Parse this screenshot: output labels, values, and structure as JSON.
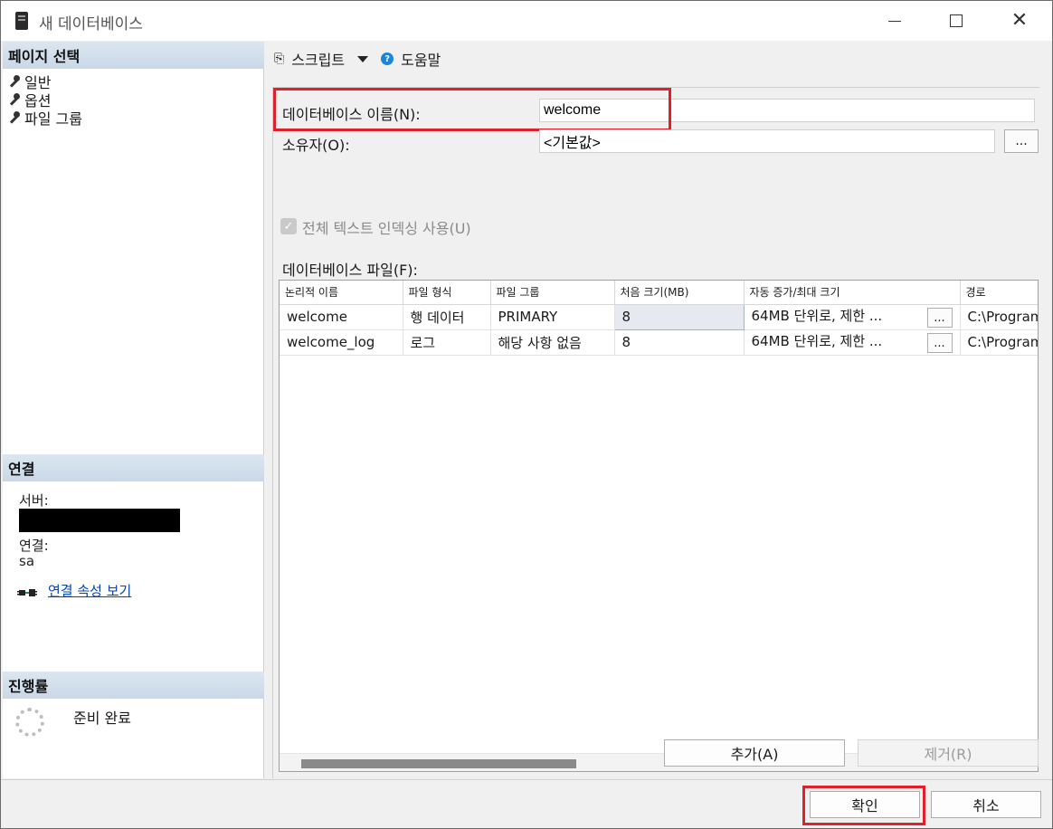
{
  "window": {
    "title": "새 데이터베이스"
  },
  "left": {
    "page_select_header": "페이지 선택",
    "pages": [
      "일반",
      "옵션",
      "파일 그룹"
    ],
    "connection_header": "연결",
    "server_label": "서버:",
    "connection_label": "연결:",
    "connection_value": "sa",
    "view_conn_props": "연결 속성 보기",
    "progress_header": "진행률",
    "progress_status": "준비 완료"
  },
  "toolbar": {
    "script_label": "스크립트",
    "help_label": "도움말"
  },
  "form": {
    "db_name_label": "데이터베이스 이름(N):",
    "db_name_value": "welcome",
    "owner_label": "소유자(O):",
    "owner_value": "<기본값>",
    "owner_browse": "...",
    "fulltext_label": "전체 텍스트 인덱싱 사용(U)",
    "files_label": "데이터베이스 파일(F):"
  },
  "grid": {
    "columns": [
      "논리적 이름",
      "파일 형식",
      "파일 그룹",
      "처음 크기(MB)",
      "자동 증가/최대 크기",
      "경로"
    ],
    "rows": [
      {
        "name": "welcome",
        "type": "행 데이터",
        "group": "PRIMARY",
        "size": "8",
        "autogrowth": "64MB 단위로, 제한 ...",
        "path": "C:\\Program"
      },
      {
        "name": "welcome_log",
        "type": "로그",
        "group": "해당 사항 없음",
        "size": "8",
        "autogrowth": "64MB 단위로, 제한 ...",
        "path": "C:\\Program"
      }
    ],
    "cell_button": "..."
  },
  "buttons": {
    "add": "추가(A)",
    "remove": "제거(R)",
    "ok": "확인",
    "cancel": "취소"
  },
  "colors": {
    "highlight": "#e0202a",
    "header_bg": "#c9d8e8",
    "link": "#0645ad"
  }
}
